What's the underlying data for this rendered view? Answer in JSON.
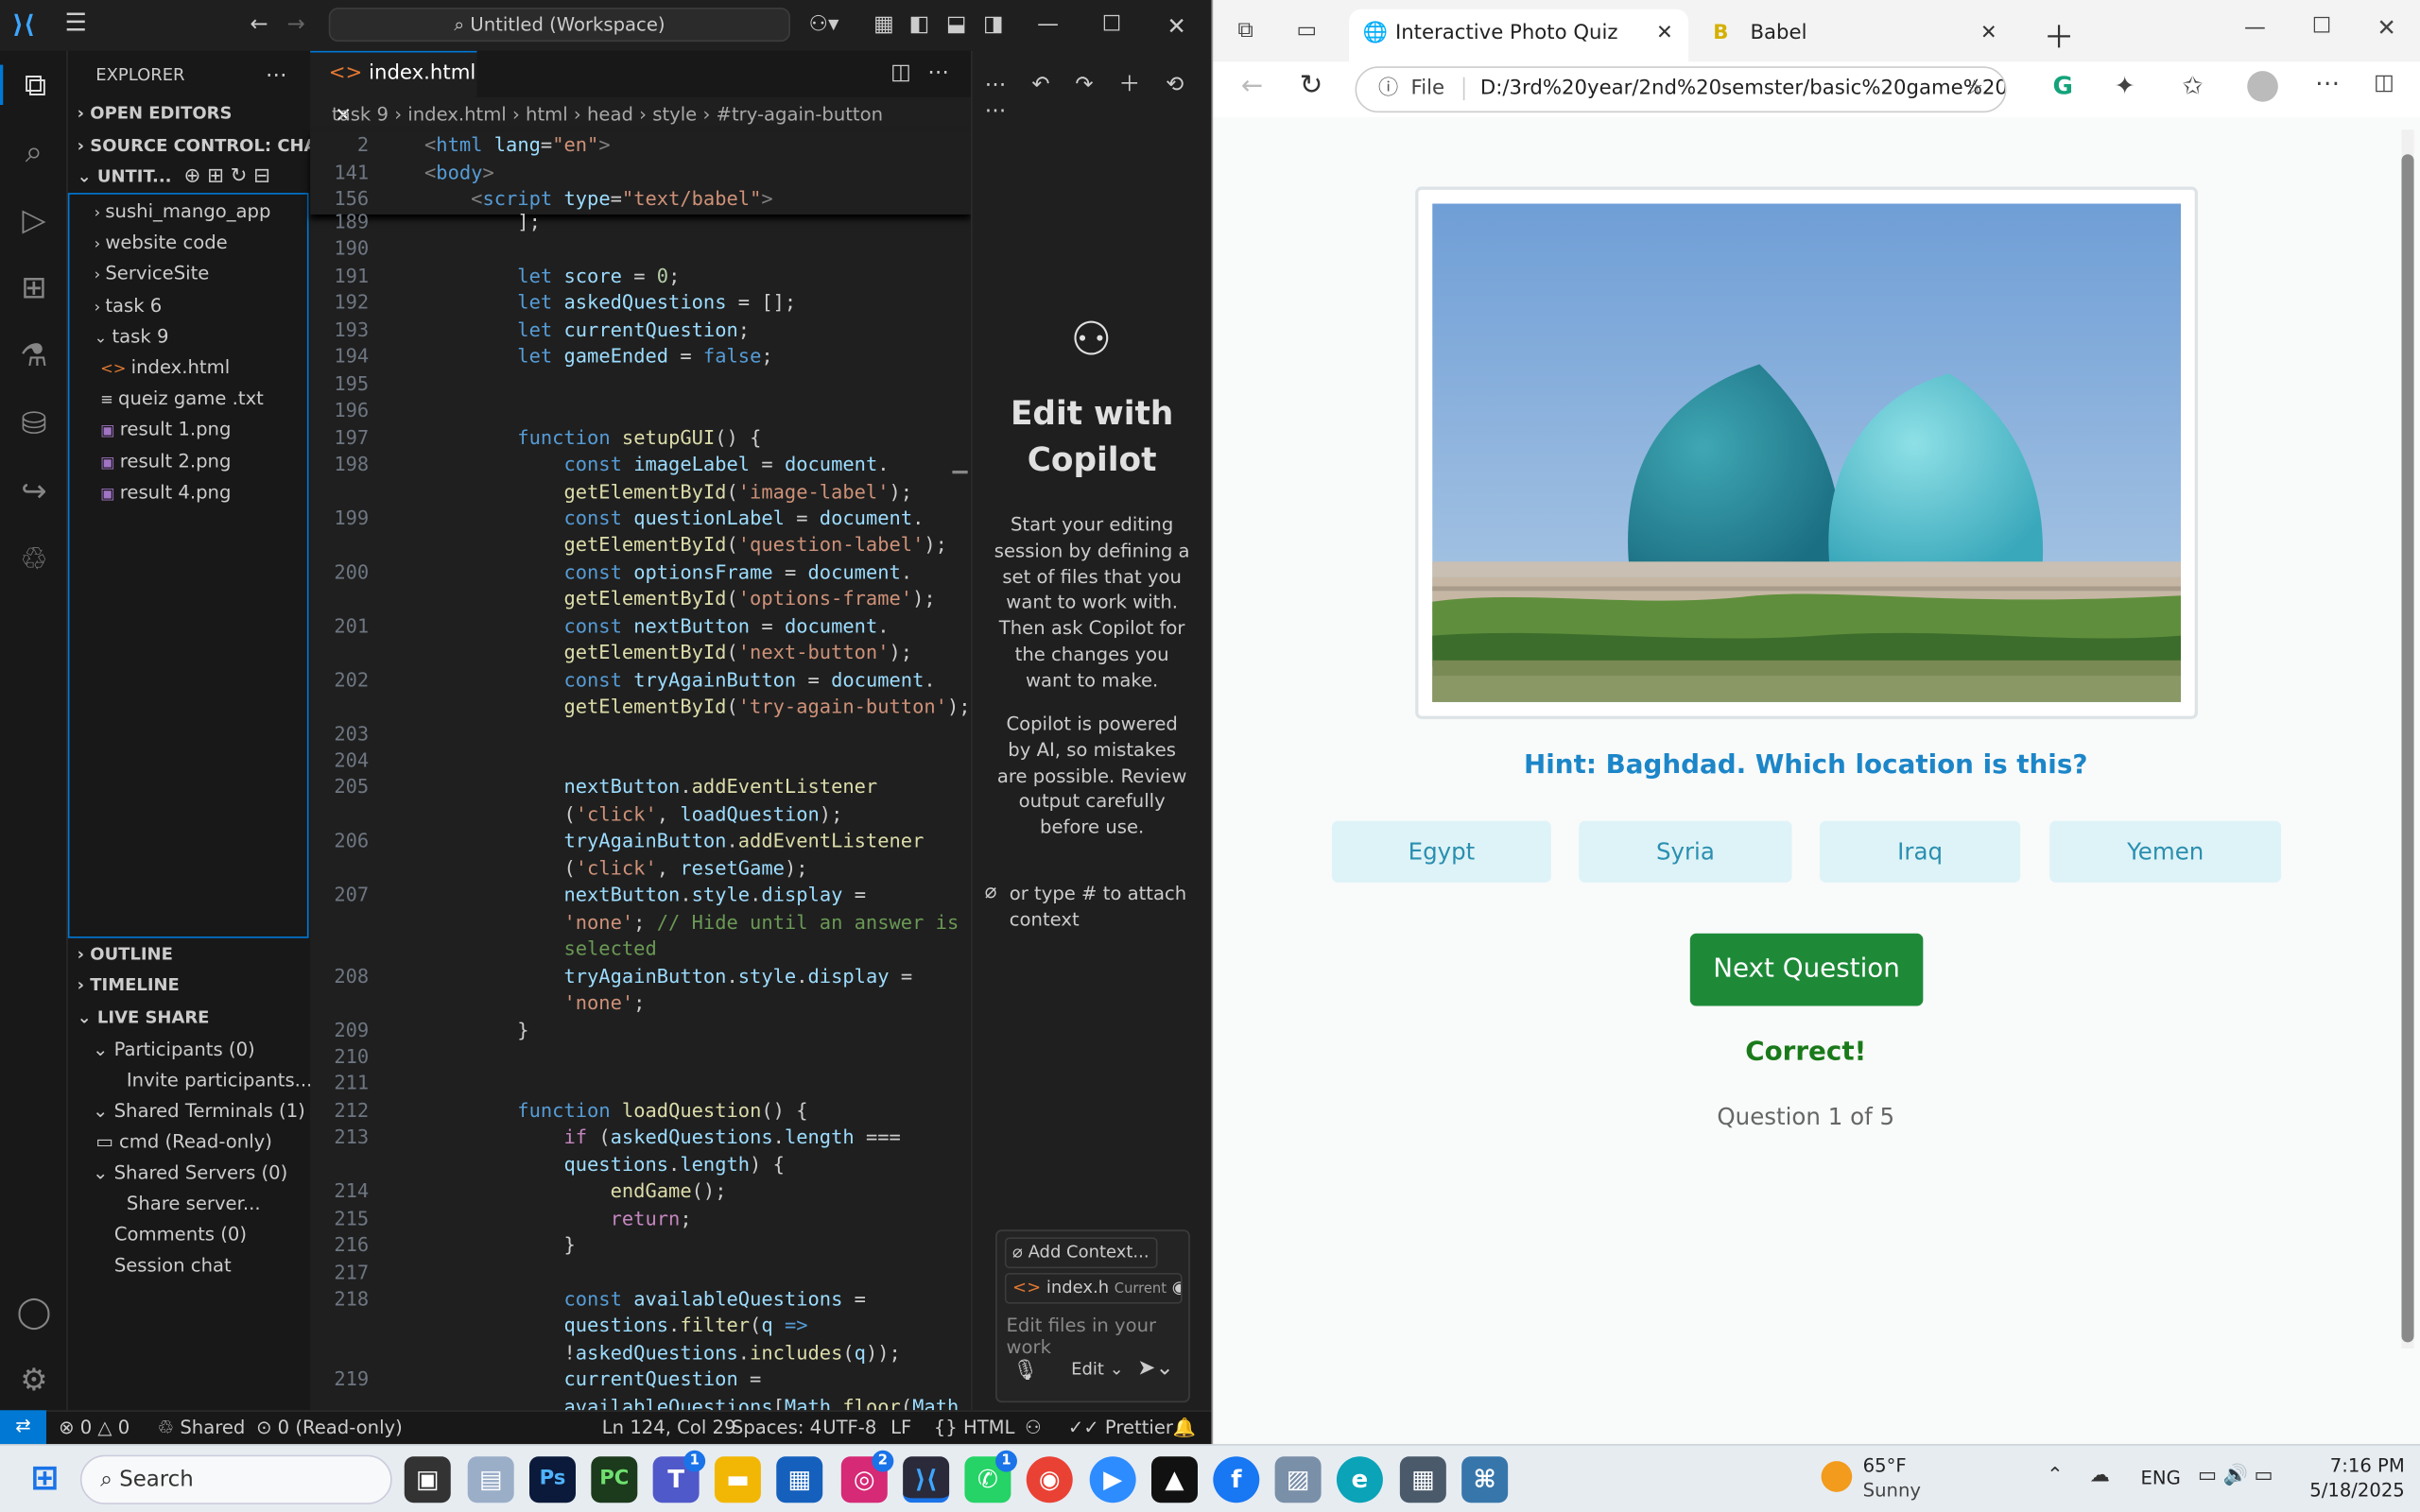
{
  "vscode": {
    "search_label": "Untitled (Workspace)",
    "explorer_title": "EXPLORER",
    "sections": {
      "open_editors": "OPEN EDITORS",
      "source_control": "SOURCE CONTROL: CHAN...",
      "workspace": "UNTIT...",
      "outline": "OUTLINE",
      "timeline": "TIMELINE",
      "live_share": "LIVE SHARE"
    },
    "tree": [
      {
        "label": "sushi_mango_app",
        "type": "folder"
      },
      {
        "label": "website code",
        "type": "folder"
      },
      {
        "label": "ServiceSite",
        "type": "folder"
      },
      {
        "label": "task 6",
        "type": "folder"
      },
      {
        "label": "task 9",
        "type": "folder-open"
      },
      {
        "label": "index.html",
        "type": "html"
      },
      {
        "label": "queiz game .txt",
        "type": "txt"
      },
      {
        "label": "result 1.png",
        "type": "img"
      },
      {
        "label": "result 2.png",
        "type": "img"
      },
      {
        "label": "result 4.png",
        "type": "img"
      }
    ],
    "live_share": [
      "Participants (0)",
      "Invite participants...",
      "Shared Terminals (1)",
      "cmd (Read-only)",
      "Shared Servers (0)",
      "Share server...",
      "Comments (0)",
      "Session chat"
    ],
    "tab_label": "index.html",
    "breadcrumb": [
      "task 9",
      "index.html",
      "html",
      "head",
      "style",
      "#try-again-button"
    ],
    "sticky": [
      {
        "ln": "2",
        "html": "<span class='pun'>&lt;</span><span class='tag'>html</span> <span class='attr'>lang</span>=<span class='str'>\"en\"</span><span class='pun'>&gt;</span>"
      },
      {
        "ln": "141",
        "html": "<span class='pun'>&lt;</span><span class='tag'>body</span><span class='pun'>&gt;</span>"
      },
      {
        "ln": "156",
        "html": "&nbsp;&nbsp;&nbsp;&nbsp;<span class='pun'>&lt;</span><span class='tag'>script</span> <span class='attr'>type</span>=<span class='str'>\"text/babel\"</span><span class='pun'>&gt;</span>"
      }
    ],
    "code": [
      {
        "ln": "189",
        "html": "        ];"
      },
      {
        "ln": "190",
        "html": ""
      },
      {
        "ln": "191",
        "html": "        <span class='kw'>let</span> <span class='var'>score</span> = <span class='num'>0</span>;"
      },
      {
        "ln": "192",
        "html": "        <span class='kw'>let</span> <span class='var'>askedQuestions</span> = [];"
      },
      {
        "ln": "193",
        "html": "        <span class='kw'>let</span> <span class='var'>currentQuestion</span>;"
      },
      {
        "ln": "194",
        "html": "        <span class='kw'>let</span> <span class='var'>gameEnded</span> = <span class='kw'>false</span>;"
      },
      {
        "ln": "195",
        "html": ""
      },
      {
        "ln": "196",
        "html": ""
      },
      {
        "ln": "197",
        "html": "        <span class='kw'>function</span> <span class='fn'>setupGUI</span>() {"
      },
      {
        "ln": "198",
        "html": "            <span class='kw'>const</span> <span class='var'>imageLabel</span> = <span class='var'>document</span>."
      },
      {
        "ln": "",
        "html": "            <span class='fn'>getElementById</span>(<span class='str'>'image-label'</span>);"
      },
      {
        "ln": "199",
        "html": "            <span class='kw'>const</span> <span class='var'>questionLabel</span> = <span class='var'>document</span>."
      },
      {
        "ln": "",
        "html": "            <span class='fn'>getElementById</span>(<span class='str'>'question-label'</span>);"
      },
      {
        "ln": "200",
        "html": "            <span class='kw'>const</span> <span class='var'>optionsFrame</span> = <span class='var'>document</span>."
      },
      {
        "ln": "",
        "html": "            <span class='fn'>getElementById</span>(<span class='str'>'options-frame'</span>);"
      },
      {
        "ln": "201",
        "html": "            <span class='kw'>const</span> <span class='var'>nextButton</span> = <span class='var'>document</span>."
      },
      {
        "ln": "",
        "html": "            <span class='fn'>getElementById</span>(<span class='str'>'next-button'</span>);"
      },
      {
        "ln": "202",
        "html": "            <span class='kw'>const</span> <span class='var'>tryAgainButton</span> = <span class='var'>document</span>."
      },
      {
        "ln": "",
        "html": "            <span class='fn'>getElementById</span>(<span class='str'>'try-again-button'</span>);"
      },
      {
        "ln": "203",
        "html": ""
      },
      {
        "ln": "204",
        "html": ""
      },
      {
        "ln": "205",
        "html": "            <span class='var'>nextButton</span>.<span class='fn'>addEventListener</span>"
      },
      {
        "ln": "",
        "html": "            (<span class='str'>'click'</span>, <span class='var'>loadQuestion</span>);"
      },
      {
        "ln": "206",
        "html": "            <span class='var'>tryAgainButton</span>.<span class='fn'>addEventListener</span>"
      },
      {
        "ln": "",
        "html": "            (<span class='str'>'click'</span>, <span class='var'>resetGame</span>);"
      },
      {
        "ln": "207",
        "html": "            <span class='var'>nextButton</span>.<span class='var'>style</span>.<span class='var'>display</span> ="
      },
      {
        "ln": "",
        "html": "            <span class='str'>'none'</span>; <span class='com'>// Hide until an answer is</span>"
      },
      {
        "ln": "",
        "html": "            <span class='com'>selected</span>"
      },
      {
        "ln": "208",
        "html": "            <span class='var'>tryAgainButton</span>.<span class='var'>style</span>.<span class='var'>display</span> ="
      },
      {
        "ln": "",
        "html": "            <span class='str'>'none'</span>;"
      },
      {
        "ln": "209",
        "html": "        }"
      },
      {
        "ln": "210",
        "html": ""
      },
      {
        "ln": "211",
        "html": ""
      },
      {
        "ln": "212",
        "html": "        <span class='kw'>function</span> <span class='fn'>loadQuestion</span>() {"
      },
      {
        "ln": "213",
        "html": "            <span class='ctl'>if</span> (<span class='var'>askedQuestions</span>.<span class='var'>length</span> ==="
      },
      {
        "ln": "",
        "html": "            <span class='var'>questions</span>.<span class='var'>length</span>) {"
      },
      {
        "ln": "214",
        "html": "                <span class='fn'>endGame</span>();"
      },
      {
        "ln": "215",
        "html": "                <span class='ctl'>return</span>;"
      },
      {
        "ln": "216",
        "html": "            }"
      },
      {
        "ln": "217",
        "html": ""
      },
      {
        "ln": "218",
        "html": "            <span class='kw'>const</span> <span class='var'>availableQuestions</span> ="
      },
      {
        "ln": "",
        "html": "            <span class='var'>questions</span>.<span class='fn'>filter</span>(<span class='var'>q</span> <span class='kw'>=&gt;</span>"
      },
      {
        "ln": "",
        "html": "            !<span class='var'>askedQuestions</span>.<span class='fn'>includes</span>(<span class='var'>q</span>));"
      },
      {
        "ln": "219",
        "html": "            <span class='var'>currentQuestion</span> ="
      },
      {
        "ln": "",
        "html": "            <span class='var'>availableQuestions</span>[<span class='var'>Math</span>.<span class='fn'>floor</span>(<span class='var'>Math</span>."
      }
    ],
    "copilot": {
      "title": "Edit with Copilot",
      "body": "Start your editing session by defining a set of files that you want to work with. Then ask Copilot for the changes you want to make.",
      "disclaimer": "Copilot is powered by AI, so mistakes are possible. Review output carefully before use.",
      "attach_hint": "or type # to attach context",
      "add_context": "Add Context...",
      "current_file": "index.h",
      "current_tag": "Current",
      "input_placeholder": "Edit files in your work",
      "mode": "Edit"
    },
    "status": {
      "errors": "0",
      "warnings": "0",
      "shared": "Shared",
      "readonly": "0 (Read-only)",
      "cursor": "Ln 124, Col 29",
      "spaces": "Spaces: 4",
      "encoding": "UTF-8",
      "eol": "LF",
      "language": "HTML",
      "prettier": "Prettier"
    }
  },
  "browser": {
    "tab_active": "Interactive Photo Quiz",
    "tab_2": "Babel",
    "url_prefix": "File",
    "url": "D:/3rd%20year/2nd%20semster/basic%20game%20...",
    "quiz": {
      "hint": "Hint: Baghdad. Which location is this?",
      "options": [
        "Egypt",
        "Syria",
        "Iraq",
        "Yemen"
      ],
      "next_label": "Next Question",
      "feedback": "Correct!",
      "progress": "Question 1 of 5"
    }
  },
  "taskbar": {
    "search_placeholder": "Search",
    "weather_temp": "65°F",
    "weather_desc": "Sunny",
    "lang": "ENG",
    "time": "7:16 PM",
    "date": "5/18/2025",
    "badges": {
      "teams": "1",
      "instagram": "2",
      "whatsapp": "1"
    }
  }
}
